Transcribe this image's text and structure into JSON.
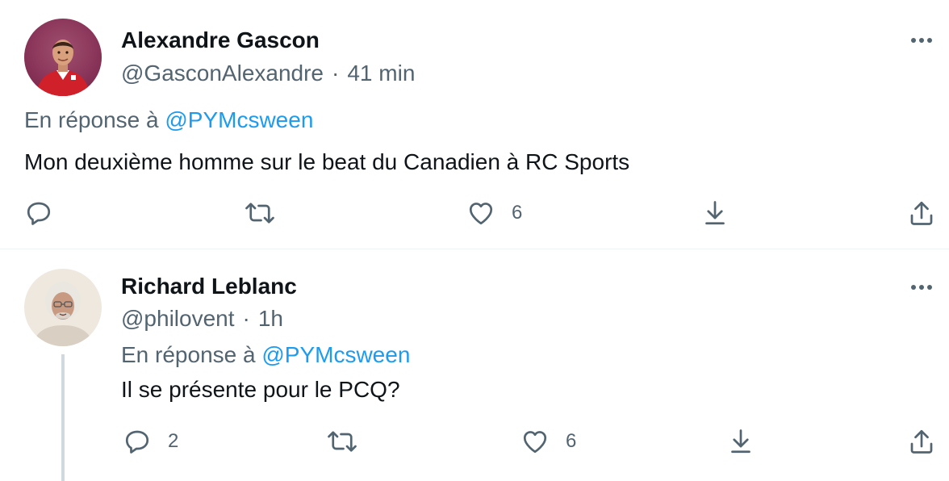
{
  "tweets": [
    {
      "author_name": "Alexandre Gascon",
      "handle": "@GasconAlexandre",
      "separator": "·",
      "time": "41 min",
      "reply_prefix": "En réponse à",
      "reply_handle": "@PYMcsween",
      "text": "Mon deuxième homme sur le beat du Canadien à RC Sports",
      "replies": "",
      "retweets": "",
      "likes": "6"
    },
    {
      "author_name": "Richard Leblanc",
      "handle": "@philovent",
      "separator": "·",
      "time": "1h",
      "reply_prefix": "En réponse à",
      "reply_handle": "@PYMcsween",
      "text": "Il se présente pour le PCQ?",
      "replies": "2",
      "retweets": "",
      "likes": "6"
    }
  ],
  "colors": {
    "text_primary": "#0f1419",
    "text_secondary": "#536471",
    "link": "#1d9bf0",
    "divider": "#eff3f4",
    "thread_line": "#cfd9de"
  },
  "icons": [
    "more-icon",
    "reply-icon",
    "retweet-icon",
    "like-icon",
    "bookmark-icon",
    "share-icon"
  ]
}
